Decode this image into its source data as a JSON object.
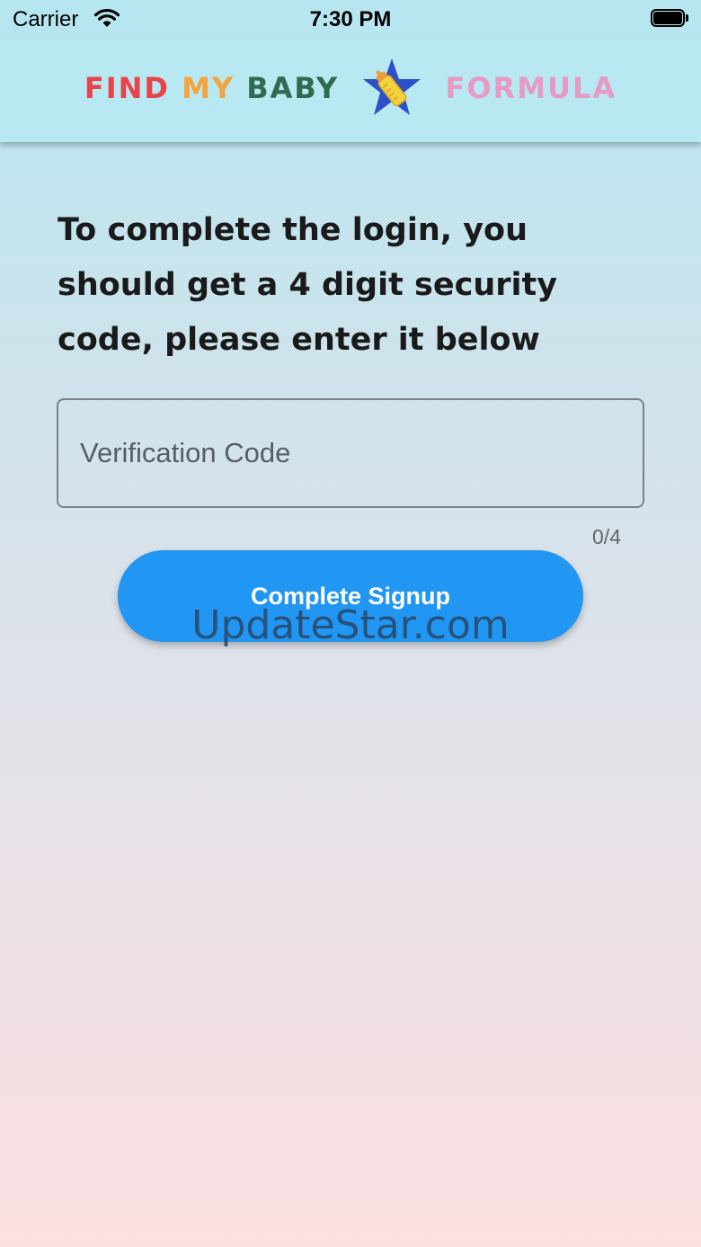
{
  "status_bar": {
    "carrier": "Carrier",
    "time": "7:30 PM"
  },
  "header": {
    "logo_words": [
      "FIND",
      "MY",
      "BABY",
      "FORMULA"
    ],
    "logo_colors": {
      "find": "#e8424a",
      "my": "#f5a33d",
      "baby": "#2f6b4f",
      "formula": "#e79ac3",
      "star": "#2d50c8",
      "bottle": "#f3d23c"
    }
  },
  "main": {
    "instruction": "To complete the login, you should get a 4 digit security code, please enter it below",
    "code_field": {
      "placeholder": "Verification Code",
      "value": "",
      "counter": "0/4"
    },
    "submit_label": "Complete Signup",
    "accent_color": "#2196f3"
  },
  "watermark": "UpdateStar.com"
}
